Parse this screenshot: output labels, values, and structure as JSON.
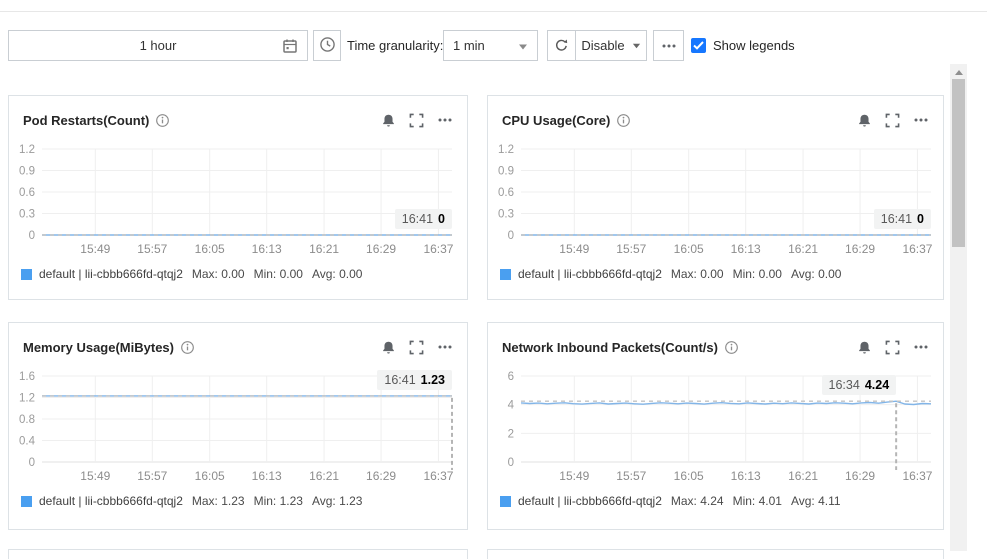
{
  "colors": {
    "accent_blue": "#1677ff",
    "legend_square_blue": "#4a9ff0",
    "series_line_blue": "#82b5e8",
    "panel_border": "#dde2e6"
  },
  "toolbar": {
    "time_range": "1 hour",
    "granularity_label": "Time granularity:",
    "granularity_value": "1 min",
    "refresh_mode": "Disable",
    "show_legends_label": "Show legends",
    "show_legends_checked": true
  },
  "panels": [
    {
      "title": "Pod Restarts(Count)",
      "legend": {
        "name": "default | lii-cbbb666fd-qtqj2",
        "max": "Max: 0.00",
        "min": "Min: 0.00",
        "avg": "Avg: 0.00"
      }
    },
    {
      "title": "CPU Usage(Core)",
      "legend": {
        "name": "default | lii-cbbb666fd-qtqj2",
        "max": "Max: 0.00",
        "min": "Min: 0.00",
        "avg": "Avg: 0.00"
      }
    },
    {
      "title": "Memory Usage(MiBytes)",
      "legend": {
        "name": "default | lii-cbbb666fd-qtqj2",
        "max": "Max: 1.23",
        "min": "Min: 1.23",
        "avg": "Avg: 1.23"
      }
    },
    {
      "title": "Network Inbound Packets(Count/s)",
      "legend": {
        "name": "default | lii-cbbb666fd-qtqj2",
        "max": "Max: 4.24",
        "min": "Min: 4.01",
        "avg": "Avg: 4.11"
      }
    }
  ],
  "chart_data": [
    {
      "type": "line",
      "title": "Pod Restarts(Count)",
      "x_ticklabels": [
        "15:49",
        "15:57",
        "16:05",
        "16:13",
        "16:21",
        "16:29",
        "16:37"
      ],
      "ylim": [
        0,
        1.2
      ],
      "yticks": [
        0,
        0.3,
        0.6,
        0.9,
        1.2
      ],
      "series": [
        {
          "name": "default | lii-cbbb666fd-qtqj2",
          "values": [
            0,
            0,
            0,
            0,
            0,
            0,
            0,
            0
          ],
          "max": 0.0,
          "min": 0.0,
          "avg": 0.0
        }
      ],
      "tooltip": {
        "time": "16:41",
        "value": "0"
      },
      "cursor": {
        "x_frac": 1.0,
        "value": 0,
        "vline": false
      }
    },
    {
      "type": "line",
      "title": "CPU Usage(Core)",
      "x_ticklabels": [
        "15:49",
        "15:57",
        "16:05",
        "16:13",
        "16:21",
        "16:29",
        "16:37"
      ],
      "ylim": [
        0,
        1.2
      ],
      "yticks": [
        0,
        0.3,
        0.6,
        0.9,
        1.2
      ],
      "series": [
        {
          "name": "default | lii-cbbb666fd-qtqj2",
          "values": [
            0,
            0,
            0,
            0,
            0,
            0,
            0,
            0
          ],
          "max": 0.0,
          "min": 0.0,
          "avg": 0.0
        }
      ],
      "tooltip": {
        "time": "16:41",
        "value": "0"
      },
      "cursor": {
        "x_frac": 1.0,
        "value": 0,
        "vline": false
      }
    },
    {
      "type": "line",
      "title": "Memory Usage(MiBytes)",
      "x_ticklabels": [
        "15:49",
        "15:57",
        "16:05",
        "16:13",
        "16:21",
        "16:29",
        "16:37"
      ],
      "ylim": [
        0,
        1.6
      ],
      "yticks": [
        0,
        0.4,
        0.8,
        1.2,
        1.6
      ],
      "series": [
        {
          "name": "default | lii-cbbb666fd-qtqj2",
          "values": [
            1.23,
            1.23,
            1.23,
            1.23,
            1.23,
            1.23,
            1.23,
            1.23
          ],
          "max": 1.23,
          "min": 1.23,
          "avg": 1.23
        }
      ],
      "tooltip": {
        "time": "16:41",
        "value": "1.23"
      },
      "cursor": {
        "x_frac": 1.0,
        "value": 1.23,
        "vline": true
      }
    },
    {
      "type": "line",
      "title": "Network Inbound Packets(Count/s)",
      "x_ticklabels": [
        "15:49",
        "15:57",
        "16:05",
        "16:13",
        "16:21",
        "16:29",
        "16:37"
      ],
      "ylim": [
        0,
        6
      ],
      "yticks": [
        0,
        2,
        4,
        6
      ],
      "series": [
        {
          "name": "default | lii-cbbb666fd-qtqj2",
          "values": [
            4.12,
            4.08,
            4.11,
            4.06,
            4.1,
            4.13,
            4.07,
            4.04,
            4.09,
            4.12,
            4.05,
            4.08,
            4.11,
            4.06,
            4.03,
            4.09,
            4.13,
            4.1,
            4.06,
            4.11,
            4.08,
            4.04,
            4.1,
            4.14,
            4.09,
            4.06,
            4.12,
            4.08,
            4.05,
            4.1,
            4.07,
            4.12,
            4.09,
            4.05,
            4.11,
            4.08,
            4.13,
            4.1,
            4.06,
            4.12,
            4.15,
            4.1,
            4.18,
            4.24,
            4.05,
            4.01,
            4.08,
            4.06
          ],
          "max": 4.24,
          "min": 4.01,
          "avg": 4.11
        }
      ],
      "tooltip": {
        "time": "16:34",
        "value": "4.24"
      },
      "cursor": {
        "x_frac": 0.915,
        "value": 4.24,
        "vline": true
      }
    }
  ]
}
